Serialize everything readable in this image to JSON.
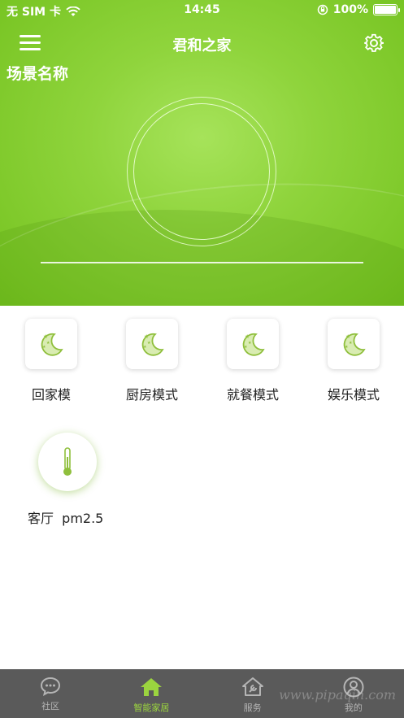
{
  "status_bar": {
    "carrier": "无 SIM 卡",
    "time": "14:45",
    "battery": "100%"
  },
  "header": {
    "title": "君和之家",
    "scene_name": "场景名称"
  },
  "scenes": [
    {
      "label": "回家模",
      "icon": "moon-stars-icon"
    },
    {
      "label": "厨房模式",
      "icon": "moon-stars-icon"
    },
    {
      "label": "就餐模式",
      "icon": "moon-stars-icon"
    },
    {
      "label": "娱乐模式",
      "icon": "moon-stars-icon"
    }
  ],
  "sensors": [
    {
      "label": "客厅  pm2.5",
      "icon": "thermometer-icon"
    }
  ],
  "tabs": [
    {
      "label": "社区",
      "icon": "chat-bubble-icon",
      "active": false
    },
    {
      "label": "智能家居",
      "icon": "home-icon",
      "active": true
    },
    {
      "label": "服务",
      "icon": "house-wrench-icon",
      "active": false
    },
    {
      "label": "我的",
      "icon": "user-icon",
      "active": false
    }
  ],
  "colors": {
    "accent": "#9bd43f",
    "hero": "#8fd43c",
    "tabbar": "#5a5a5a"
  },
  "watermark": "www.pipaqin.com"
}
